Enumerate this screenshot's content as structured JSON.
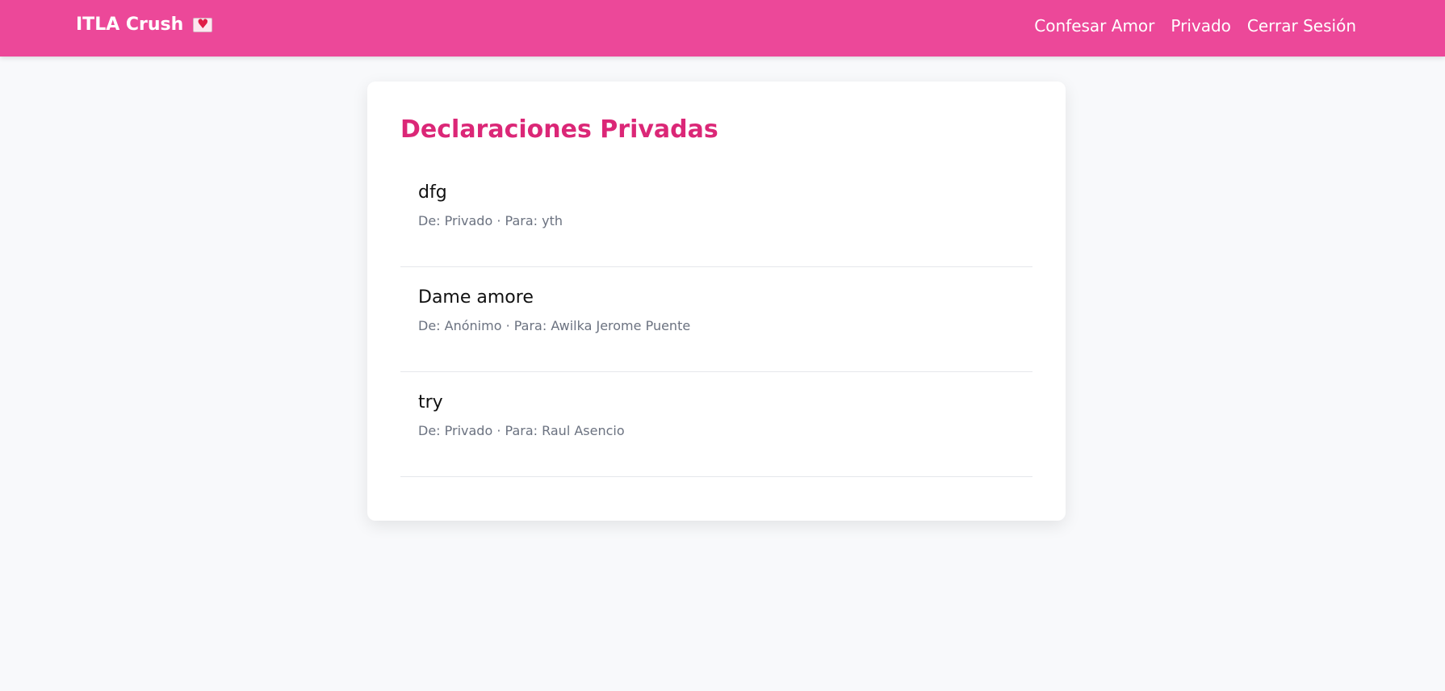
{
  "navbar": {
    "brand": "ITLA Crush",
    "brand_icon": "love-letter-icon",
    "color": "#ec4899",
    "links": [
      {
        "label": "Confesar Amor"
      },
      {
        "label": "Privado"
      },
      {
        "label": "Cerrar Sesión"
      }
    ]
  },
  "main": {
    "title": "Declaraciones Privadas",
    "title_color": "#db2777",
    "items": [
      {
        "title": "dfg",
        "meta": "De: Privado · Para: yth"
      },
      {
        "title": "Dame amore",
        "meta": "De: Anónimo · Para: Awilka Jerome Puente"
      },
      {
        "title": "try",
        "meta": "De: Privado · Para: Raul Asencio"
      }
    ]
  }
}
